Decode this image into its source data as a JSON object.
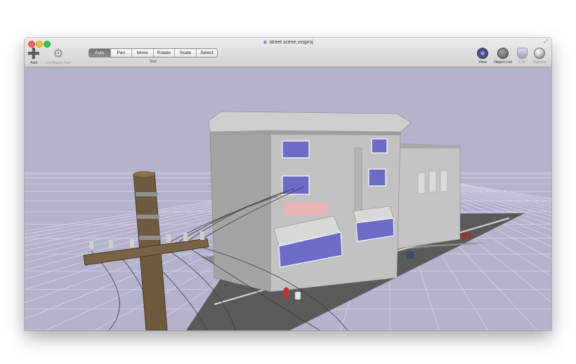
{
  "window": {
    "title": "street scene.vssproj"
  },
  "toolbar": {
    "add_label": "Add",
    "configure_label": "Configure Tool",
    "tool_caption": "Tool",
    "tools": [
      {
        "label": "Auto",
        "active": true
      },
      {
        "label": "Pan",
        "active": false
      },
      {
        "label": "Move",
        "active": false
      },
      {
        "label": "Rotate",
        "active": false
      },
      {
        "label": "Scale",
        "active": false
      },
      {
        "label": "Select",
        "active": false
      }
    ],
    "right": [
      {
        "label": "View",
        "icon": "view-icon",
        "enabled": true
      },
      {
        "label": "Object List",
        "icon": "object-list-icon",
        "enabled": true
      },
      {
        "label": "Edit",
        "icon": "edit-icon",
        "enabled": false
      },
      {
        "label": "Material",
        "icon": "material-icon",
        "enabled": false
      }
    ]
  },
  "colors": {
    "viewport_background": "#b3b3cd",
    "grid": "#d8d8e8",
    "road": "#5c5c5c",
    "building": "#bebebe",
    "window_glass": "#6c6cc8",
    "hydrant": "#c23030",
    "pole": "#6e5a3e",
    "active_tool": "#7a7a7a"
  },
  "icons": {
    "add": "plus-icon",
    "configure": "gear-icon",
    "document": "document-icon",
    "fullscreen": "fullscreen-icon"
  }
}
